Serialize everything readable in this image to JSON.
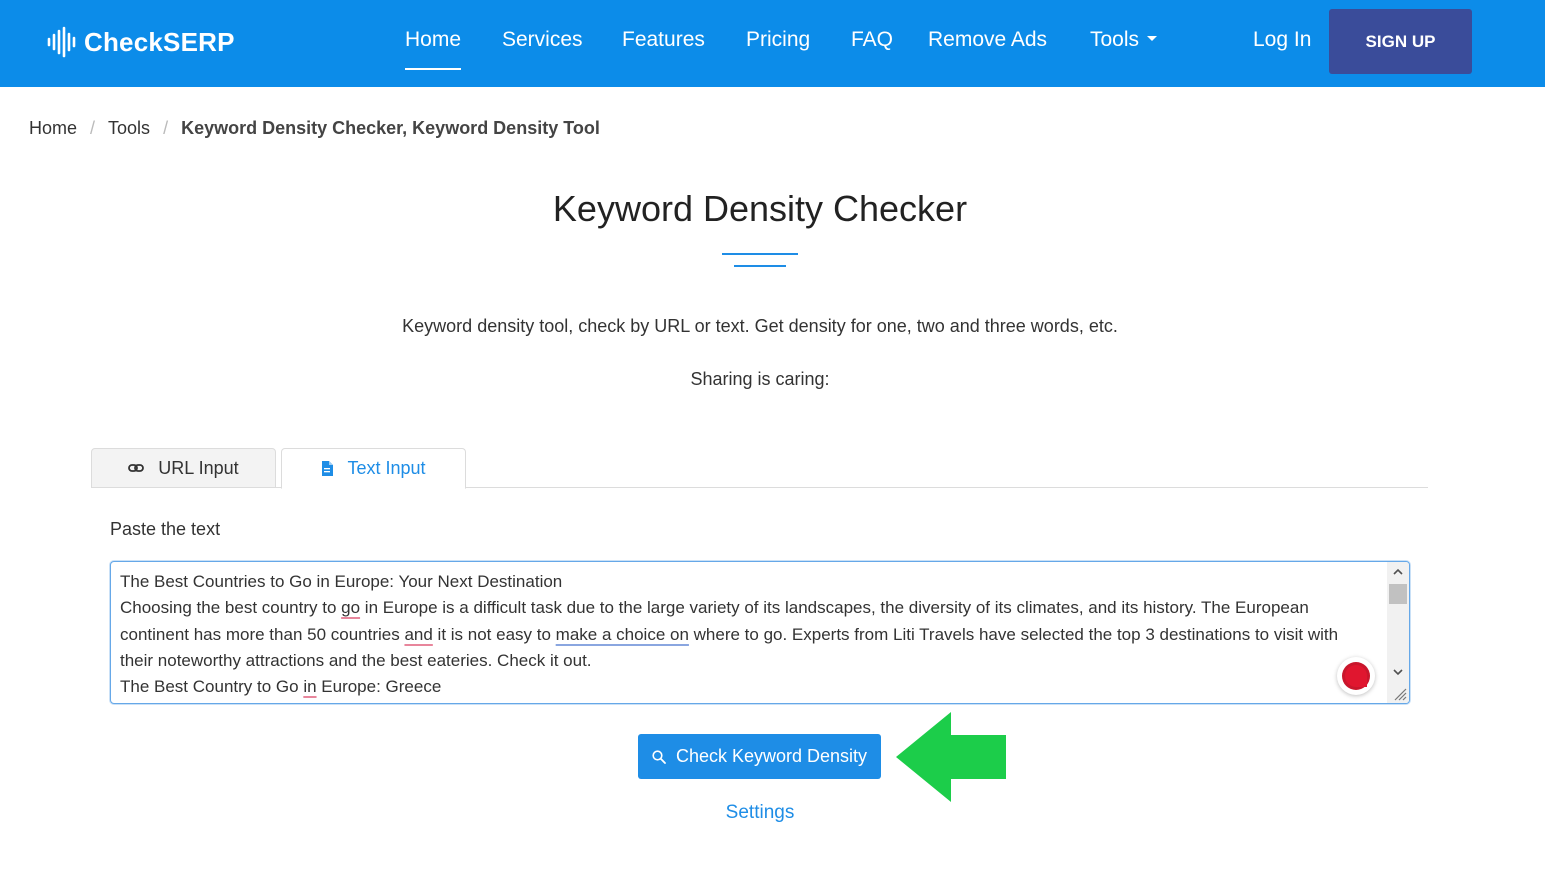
{
  "header": {
    "logo_text": "CheckSERP",
    "nav": [
      {
        "label": "Home",
        "active": true
      },
      {
        "label": "Services"
      },
      {
        "label": "Features"
      },
      {
        "label": "Pricing"
      },
      {
        "label": "FAQ"
      },
      {
        "label": "Remove Ads"
      },
      {
        "label": "Tools"
      }
    ],
    "login": "Log In",
    "signup": "SIGN UP"
  },
  "breadcrumb": {
    "home": "Home",
    "tools": "Tools",
    "current": "Keyword Density Checker, Keyword Density Tool"
  },
  "main": {
    "title": "Keyword Density Checker",
    "subtitle": "Keyword density tool, check by URL or text. Get density for one, two and three words, etc.",
    "sharing": "Sharing is caring:"
  },
  "tabs": {
    "url": "URL Input",
    "text": "Text Input"
  },
  "form": {
    "paste_label": "Paste the text",
    "text_lines": {
      "l1": "The Best Countries to Go in Europe: Your Next Destination",
      "l2a": "Choosing the best country to ",
      "l2b": "go",
      "l2c": " in Europe is a difficult task due to the large variety of its landscapes, the diversity of its climates, and its history. The European",
      "l3a": "continent has more than 50 countries ",
      "l3b": "and",
      "l3c": " it is not easy to ",
      "l3d": "make a choice on",
      "l3e": " where to go. Experts from Liti Travels have selected the top 3 destinations to visit with",
      "l4": "their noteworthy attractions and the best eateries. Check it out.",
      "l5a": "The Best Country to Go ",
      "l5b": "in",
      "l5c": " Europe: Greece"
    },
    "button": "Check Keyword Density",
    "settings": "Settings"
  },
  "colors": {
    "header_bg": "#0c8ce9",
    "signup_bg": "#3a4c9a",
    "accent": "#1e8de6",
    "arrow": "#1ccd4a"
  }
}
